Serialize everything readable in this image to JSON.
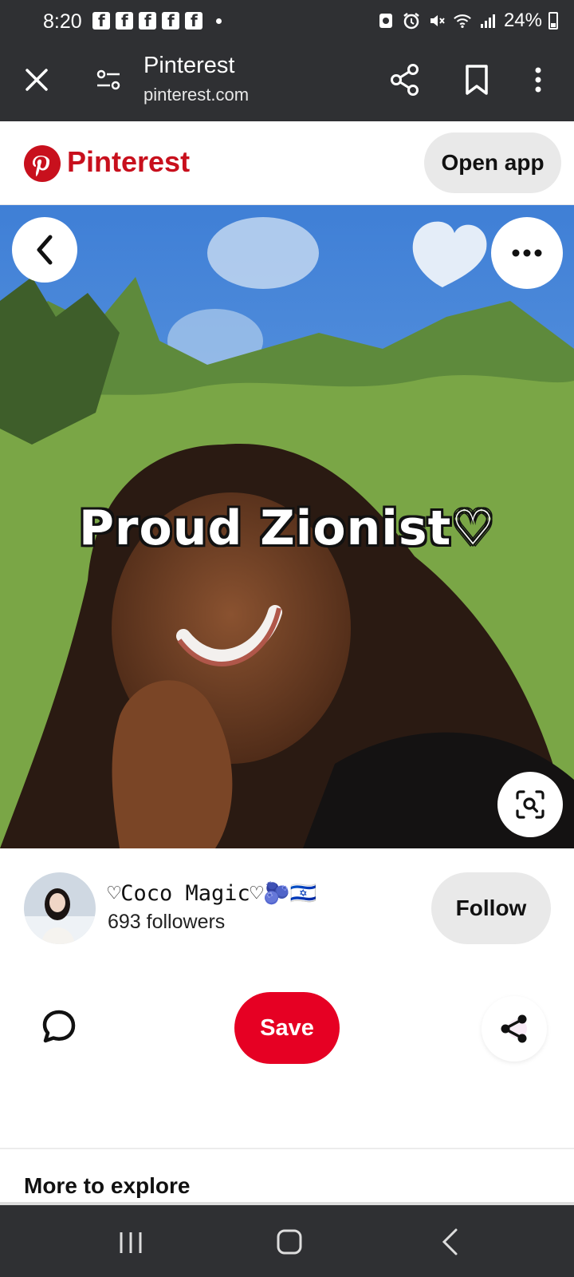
{
  "status_bar": {
    "time": "8:20",
    "battery": "24%",
    "notification_icons": [
      "facebook-icon",
      "facebook-icon",
      "facebook-icon",
      "facebook-icon",
      "facebook-icon"
    ]
  },
  "browser": {
    "title": "Pinterest",
    "url": "pinterest.com"
  },
  "header": {
    "brand": "Pinterest",
    "open_app_label": "Open app",
    "brand_color": "#c8101d"
  },
  "pin": {
    "overlay_text": "Proud Zionist♡"
  },
  "creator": {
    "name": "♡Coco Magic♡🫐🇮🇱",
    "followers": "693 followers",
    "follow_label": "Follow"
  },
  "actions": {
    "save_label": "Save",
    "save_color": "#e60023"
  },
  "section": {
    "more_to_explore": "More to explore"
  }
}
